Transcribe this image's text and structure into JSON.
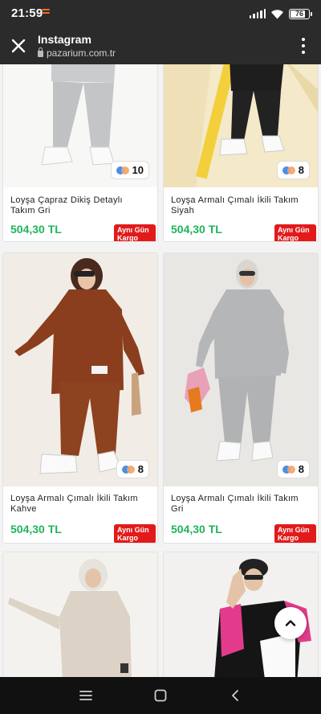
{
  "status_bar": {
    "time": "21:59",
    "battery": "76"
  },
  "browser": {
    "title": "Instagram",
    "url": "pazarium.com.tr"
  },
  "products": [
    {
      "name": "Loyşa Çapraz Dikiş Detaylı Takım Gri",
      "price": "504,30 TL",
      "variants": "10",
      "shipping": [
        "Aynı Gün",
        "Kargo"
      ]
    },
    {
      "name": "Loyşa Armalı Çımalı İkili Takım Siyah",
      "price": "504,30 TL",
      "variants": "8",
      "shipping": [
        "Aynı Gün",
        "Kargo"
      ]
    },
    {
      "name": "Loyşa Armalı Çımalı İkili Takım Kahve",
      "price": "504,30 TL",
      "variants": "8",
      "shipping": [
        "Aynı Gün",
        "Kargo"
      ]
    },
    {
      "name": "Loyşa Armalı Çımalı İkili Takım Gri",
      "price": "504,30 TL",
      "variants": "8",
      "shipping": [
        "Aynı Gün",
        "Kargo"
      ]
    },
    {
      "name": "",
      "price": "",
      "variants": "",
      "shipping": []
    },
    {
      "name": "",
      "price": "",
      "variants": "",
      "shipping": []
    }
  ],
  "icons": {
    "close": "close-icon",
    "menu": "more-vert-icon",
    "scroll_top": "chevron-up-icon",
    "nav_menu": "menu-icon",
    "nav_home": "square-icon",
    "nav_back": "back-icon"
  },
  "colors": {
    "price": "#1fb55a",
    "shipping_badge": "#e21a1a",
    "topbar": "#2b2b2b"
  }
}
